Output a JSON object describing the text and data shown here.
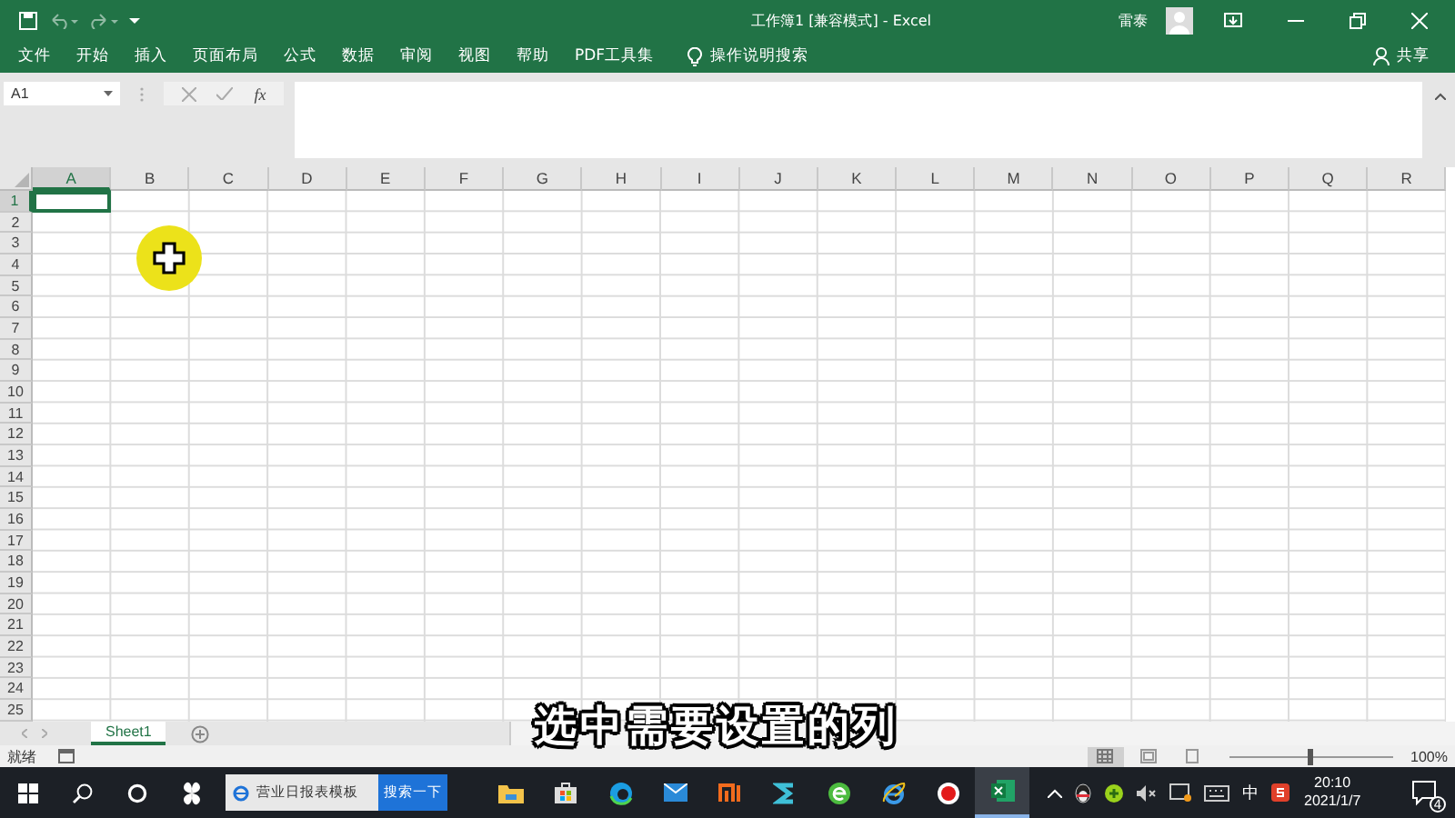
{
  "title_bar": {
    "title": "工作簿1 [兼容模式] - Excel",
    "user": "雷泰"
  },
  "ribbon_tabs": [
    {
      "label": "文件"
    },
    {
      "label": "开始"
    },
    {
      "label": "插入"
    },
    {
      "label": "页面布局"
    },
    {
      "label": "公式"
    },
    {
      "label": "数据"
    },
    {
      "label": "审阅"
    },
    {
      "label": "视图"
    },
    {
      "label": "帮助"
    },
    {
      "label": "PDF工具集"
    }
  ],
  "tell_me": "操作说明搜索",
  "share": "共享",
  "formula_bar": {
    "name_box": "A1",
    "function_label": "fx"
  },
  "sheet": {
    "columns": [
      {
        "label": "A",
        "selected": true
      },
      {
        "label": "B",
        "selected": false
      },
      {
        "label": "C",
        "selected": false
      },
      {
        "label": "D",
        "selected": false
      },
      {
        "label": "E",
        "selected": false
      },
      {
        "label": "F",
        "selected": false
      },
      {
        "label": "G",
        "selected": false
      },
      {
        "label": "H",
        "selected": false
      },
      {
        "label": "I",
        "selected": false
      },
      {
        "label": "J",
        "selected": false
      },
      {
        "label": "K",
        "selected": false
      },
      {
        "label": "L",
        "selected": false
      },
      {
        "label": "M",
        "selected": false
      },
      {
        "label": "N",
        "selected": false
      },
      {
        "label": "O",
        "selected": false
      },
      {
        "label": "P",
        "selected": false
      },
      {
        "label": "Q",
        "selected": false
      },
      {
        "label": "R",
        "selected": false
      }
    ],
    "rows": [
      {
        "label": "1",
        "selected": true
      },
      {
        "label": "2",
        "selected": false
      },
      {
        "label": "3",
        "selected": false
      },
      {
        "label": "4",
        "selected": false
      },
      {
        "label": "5",
        "selected": false
      },
      {
        "label": "6",
        "selected": false
      },
      {
        "label": "7",
        "selected": false
      },
      {
        "label": "8",
        "selected": false
      },
      {
        "label": "9",
        "selected": false
      },
      {
        "label": "10",
        "selected": false
      },
      {
        "label": "11",
        "selected": false
      },
      {
        "label": "12",
        "selected": false
      },
      {
        "label": "13",
        "selected": false
      },
      {
        "label": "14",
        "selected": false
      },
      {
        "label": "15",
        "selected": false
      },
      {
        "label": "16",
        "selected": false
      },
      {
        "label": "17",
        "selected": false
      },
      {
        "label": "18",
        "selected": false
      },
      {
        "label": "19",
        "selected": false
      },
      {
        "label": "20",
        "selected": false
      },
      {
        "label": "21",
        "selected": false
      },
      {
        "label": "22",
        "selected": false
      },
      {
        "label": "23",
        "selected": false
      },
      {
        "label": "24",
        "selected": false
      },
      {
        "label": "25",
        "selected": false
      }
    ]
  },
  "sheet_tabs": [
    {
      "label": "Sheet1",
      "selected": true
    }
  ],
  "status_bar": {
    "status": "就绪",
    "zoom": "100%",
    "zoom_slider": {
      "level": 0.5
    }
  },
  "caption": "选中需要设置的列",
  "taskbar": {
    "search_box": "营业日报表模板",
    "search_button": "搜索一下",
    "ime": "中",
    "time": "20:10",
    "date": "2021/1/7",
    "notifications": "4"
  }
}
